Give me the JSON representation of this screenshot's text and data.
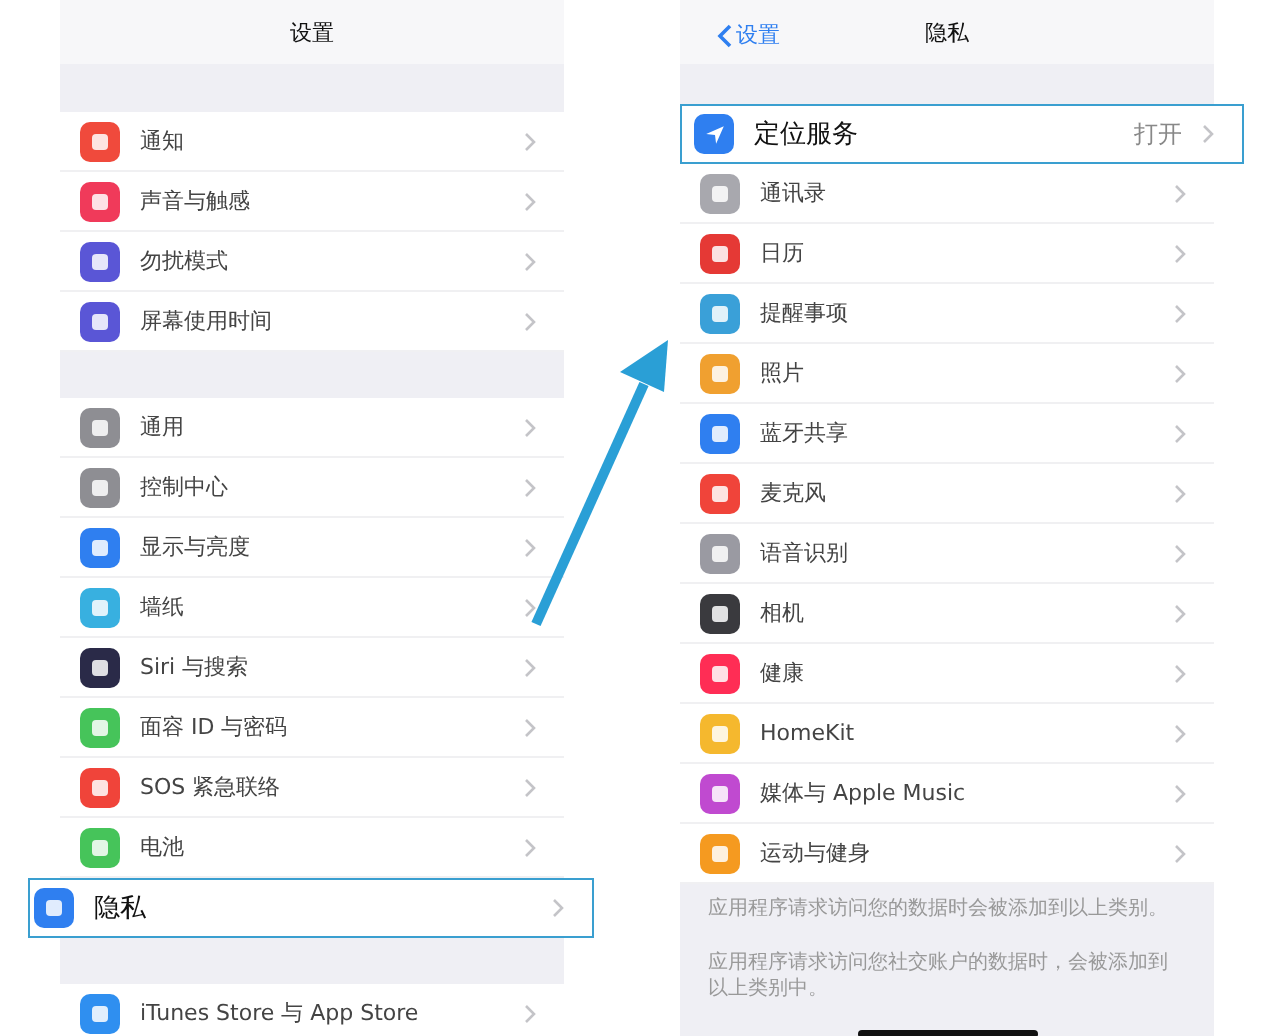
{
  "settings": {
    "title": "设置",
    "groups": [
      [
        {
          "label": "通知",
          "color": "#f04a3c",
          "highlighted": false
        },
        {
          "label": "声音与触感",
          "color": "#f03a5a",
          "highlighted": false
        },
        {
          "label": "勿扰模式",
          "color": "#5a56d6",
          "highlighted": false
        },
        {
          "label": "屏幕使用时间",
          "color": "#5a56d6",
          "highlighted": false
        }
      ],
      [
        {
          "label": "通用",
          "color": "#8e8e93",
          "highlighted": false
        },
        {
          "label": "控制中心",
          "color": "#8e8e93",
          "highlighted": false
        },
        {
          "label": "显示与亮度",
          "color": "#2f7ff0",
          "highlighted": false
        },
        {
          "label": "墙纸",
          "color": "#38b0e0",
          "highlighted": false
        },
        {
          "label": "Siri 与搜索",
          "color": "#2a2a48",
          "highlighted": false
        },
        {
          "label": "面容 ID 与密码",
          "color": "#46c45a",
          "highlighted": false
        },
        {
          "label": "SOS 紧急联络",
          "color": "#f0443a",
          "highlighted": false
        },
        {
          "label": "电池",
          "color": "#46c45a",
          "highlighted": false
        },
        {
          "label": "隐私",
          "color": "#2f7ff0",
          "highlighted": true
        }
      ],
      [
        {
          "label": "iTunes Store 与 App Store",
          "color": "#2f8ff0",
          "highlighted": false
        }
      ]
    ]
  },
  "privacy": {
    "back": "设置",
    "title": "隐私",
    "location": {
      "label": "定位服务",
      "value": "打开",
      "color": "#2f7ff0",
      "highlighted": true
    },
    "items": [
      {
        "label": "通讯录",
        "color": "#a8a8ae"
      },
      {
        "label": "日历",
        "color": "#e53935"
      },
      {
        "label": "提醒事项",
        "color": "#3aa0d8"
      },
      {
        "label": "照片",
        "color": "#f0a030"
      },
      {
        "label": "蓝牙共享",
        "color": "#2f7ff0"
      },
      {
        "label": "麦克风",
        "color": "#f0443a"
      },
      {
        "label": "语音识别",
        "color": "#9a9aa2"
      },
      {
        "label": "相机",
        "color": "#3a3a3e"
      },
      {
        "label": "健康",
        "color": "#ff2d55"
      },
      {
        "label": "HomeKit",
        "color": "#f5b82e"
      },
      {
        "label": "媒体与 Apple Music",
        "color": "#c04ad0"
      },
      {
        "label": "运动与健身",
        "color": "#f59a20"
      }
    ],
    "notes": [
      "应用程序请求访问您的数据时会被添加到以上类别。",
      "应用程序请求访问您社交账户的数据时，会被添加到以上类别中。"
    ]
  }
}
